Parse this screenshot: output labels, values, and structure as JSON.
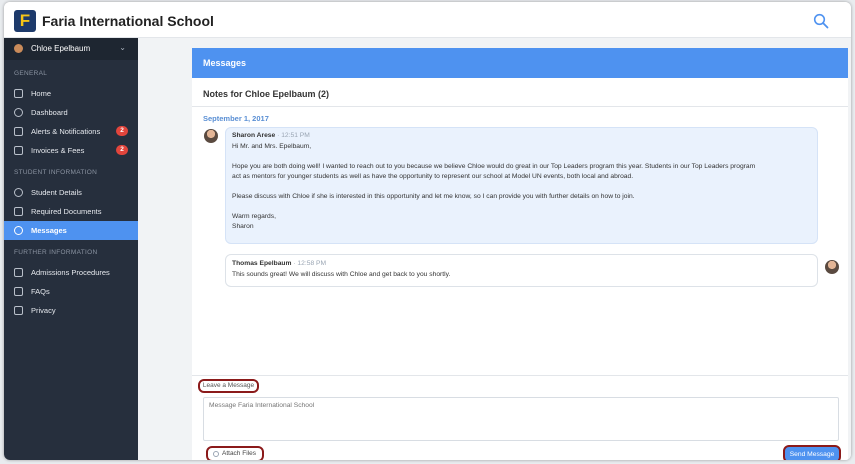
{
  "app": {
    "school_name": "Faria International School",
    "logo_letter": "F",
    "search_icon": "search-icon"
  },
  "sidebar": {
    "user_name": "Chloe Epelbaum",
    "sections": {
      "general": "GENERAL",
      "student_info": "STUDENT INFORMATION",
      "further_info": "FURTHER INFORMATION"
    },
    "items": [
      {
        "label": "Home",
        "icon": "home-icon"
      },
      {
        "label": "Dashboard",
        "icon": "dashboard-icon"
      },
      {
        "label": "Alerts & Notifications",
        "icon": "alerts-icon",
        "badge": "2"
      },
      {
        "label": "Invoices & Fees",
        "icon": "invoice-icon",
        "badge": "2"
      },
      {
        "label": "Student Details",
        "icon": "student-icon"
      },
      {
        "label": "Required Documents",
        "icon": "documents-icon"
      },
      {
        "label": "Messages",
        "icon": "messages-icon",
        "active": true
      },
      {
        "label": "Admissions Procedures",
        "icon": "admissions-icon"
      },
      {
        "label": "FAQs",
        "icon": "faq-icon"
      },
      {
        "label": "Privacy",
        "icon": "privacy-icon"
      }
    ]
  },
  "main": {
    "header": "Messages",
    "notes_title": "Notes for Chloe Epelbaum (2)",
    "date": "September 1, 2017",
    "messages": [
      {
        "author": "Sharon Arese",
        "time": "12:51 PM",
        "lines": [
          "Hi Mr. and Mrs. Epelbaum,",
          "Hope you are both doing well! I wanted to reach out to you because we believe Chloe would do great in our Top Leaders program this year. Students in our Top Leaders program",
          "act as mentors for younger students as well as have the opportunity to represent our school at Model UN events, both local and abroad.",
          "Please discuss with Chloe if she is interested in this opportunity and let me know, so I can provide you with further details on how to join.",
          "Warm regards,",
          "Sharon"
        ]
      },
      {
        "author": "Thomas Epelbaum",
        "time": "12:58 PM",
        "lines": [
          "This sounds great! We will discuss with Chloe and get back to you shortly."
        ]
      }
    ],
    "compose": {
      "leave_label": "Leave a Message",
      "placeholder": "Message Faria International School",
      "attach_label": "Attach Files",
      "send_label": "Send Message"
    }
  },
  "colors": {
    "accent": "#4e92f0",
    "sidebar_bg": "#262f3d",
    "badge": "#e2453c",
    "highlight_outline": "#8b1a1a"
  }
}
